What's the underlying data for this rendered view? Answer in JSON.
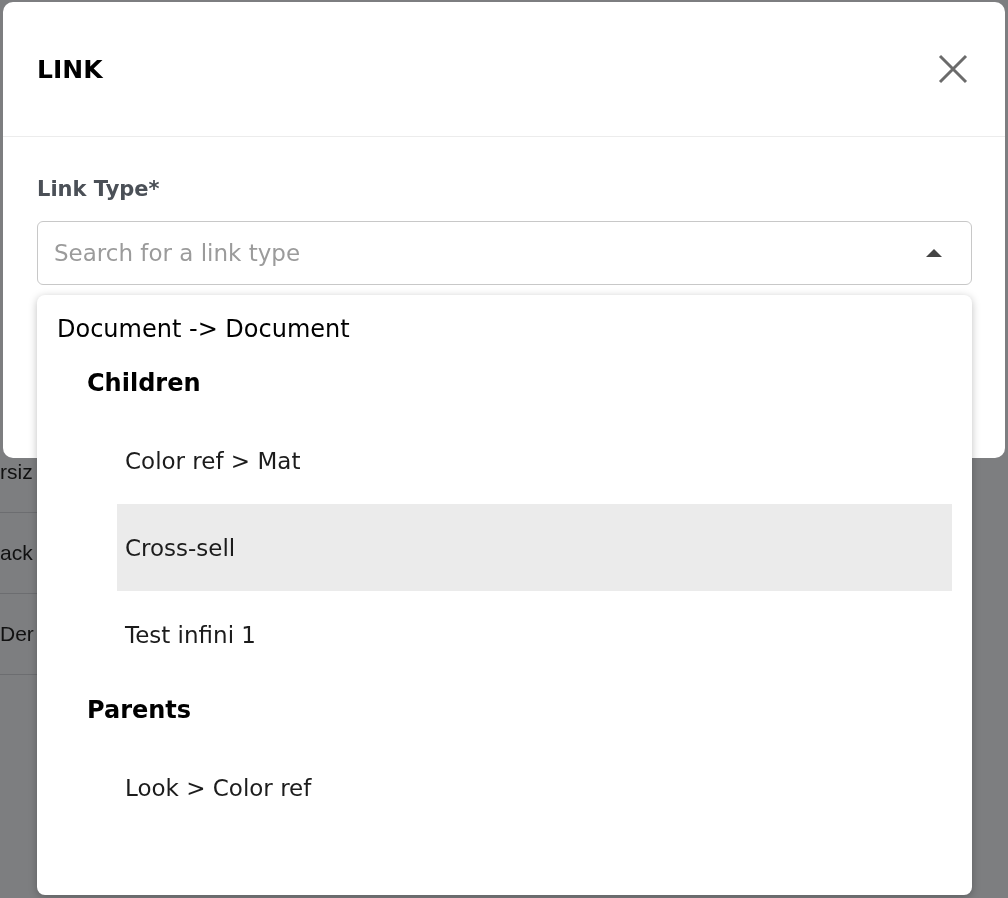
{
  "background_rows": [
    "rsiz",
    "ack",
    "Der"
  ],
  "dialog": {
    "title": "LINK",
    "field_label": "Link Type*",
    "search": {
      "placeholder": "Search for a link type",
      "expanded": true
    },
    "dropdown": {
      "groups": [
        {
          "label": "Document -> Document",
          "children": [
            {
              "label": "Children",
              "children": [
                {
                  "label": "Color ref > Mat",
                  "selected": false
                },
                {
                  "label": "Cross-sell",
                  "selected": true
                },
                {
                  "label": "Test infini 1",
                  "selected": false
                }
              ]
            },
            {
              "label": "Parents",
              "children": [
                {
                  "label": "Look > Color ref",
                  "selected": false
                }
              ]
            }
          ]
        }
      ]
    }
  }
}
